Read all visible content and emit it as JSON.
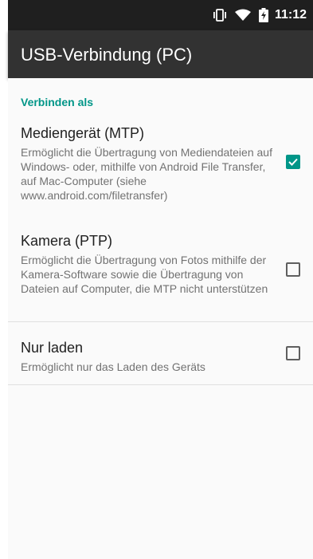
{
  "status_bar": {
    "time": "11:12",
    "icons": [
      "vibrate-icon",
      "wifi-icon",
      "battery-charging-icon"
    ]
  },
  "app_bar": {
    "title": "USB-Verbindung (PC)"
  },
  "section": {
    "header": "Verbinden als"
  },
  "options": [
    {
      "title": "Mediengerät (MTP)",
      "summary": "Ermöglicht die Übertragung von Mediendateien auf Windows- oder, mithilfe von Android File Transfer, auf Mac-Computer (siehe www.android.com/filetransfer)",
      "checked": true
    },
    {
      "title": "Kamera (PTP)",
      "summary": "Ermöglicht die Übertragung von Fotos mithilfe der Kamera-Software sowie die Übertragung von Dateien auf Computer, die MTP nicht unterstützen",
      "checked": false
    },
    {
      "title": "Nur laden",
      "summary": "Ermöglicht nur das Laden des Geräts",
      "checked": false
    }
  ],
  "colors": {
    "accent": "#009688",
    "app_bar": "#323232",
    "status_bar": "#1f1f1f"
  }
}
